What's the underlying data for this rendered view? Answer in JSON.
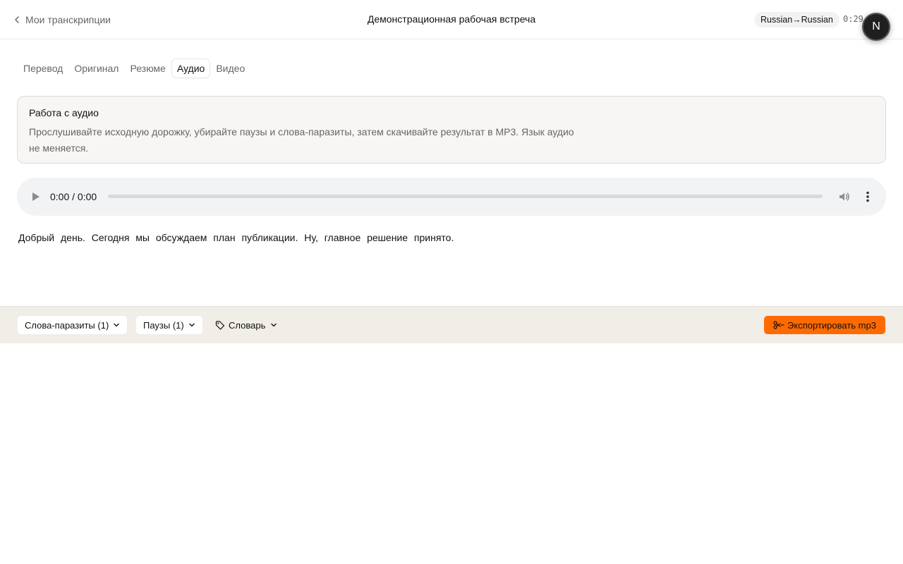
{
  "header": {
    "back_label": "Мои транскрипции",
    "title": "Демонстрационная рабочая встреча",
    "language_badge": "Russian→Russian",
    "timer": "0:29",
    "avatar_initial": "N"
  },
  "tabs": [
    {
      "label": "Перевод",
      "active": false
    },
    {
      "label": "Оригинал",
      "active": false
    },
    {
      "label": "Резюме",
      "active": false
    },
    {
      "label": "Аудио",
      "active": true
    },
    {
      "label": "Видео",
      "active": false
    }
  ],
  "info_card": {
    "title": "Работа с аудио",
    "text": "Прослушивайте исходную дорожку, убирайте паузы и слова-паразиты, затем скачивайте результат в MP3. Язык аудио не меняется."
  },
  "player": {
    "time": "0:00 / 0:00",
    "progress": 0
  },
  "transcript": {
    "text": "Добрый день. Сегодня мы обсуждаем план публикации. Ну, главное решение принято."
  },
  "toolbar": {
    "filler_words_label": "Слова-паразиты (1)",
    "pauses_label": "Паузы (1)",
    "dictionary_label": "Словарь",
    "export_label": "Экспортировать mp3"
  },
  "colors": {
    "accent": "#ff6a00",
    "toolbar_bg": "#f1ede7",
    "player_bg": "#f1f3f4"
  },
  "icons": {
    "back": "chevron-left-icon",
    "play": "play-icon",
    "volume": "volume-icon",
    "more": "more-vertical-icon",
    "dropdown": "chevron-down-icon",
    "dictionary": "tag-icon",
    "export": "scissors-icon"
  }
}
